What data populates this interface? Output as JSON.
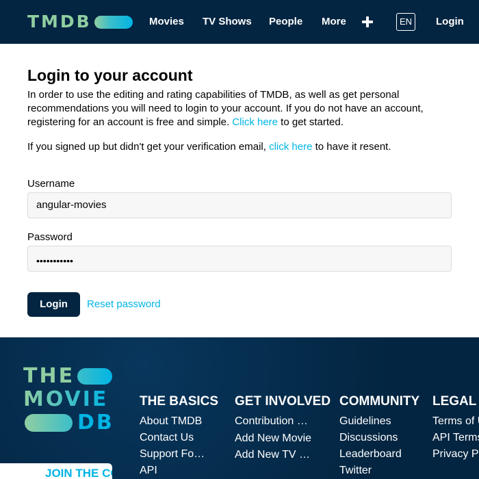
{
  "header": {
    "logo_text": "TMDB",
    "nav": [
      "Movies",
      "TV Shows",
      "People",
      "More"
    ],
    "add_icon": "plus-icon",
    "language": "EN",
    "login": "Login"
  },
  "main": {
    "title": "Login to your account",
    "intro_text": "In order to use the editing and rating capabilities of TMDB, as well as get personal recommendations you will need to login to your account. If you do not have an account, registering for an account is free and simple. ",
    "intro_link": "Click here",
    "intro_after": " to get started.",
    "verify_before": "If you signed up but didn't get your verification email, ",
    "verify_link": "click here",
    "verify_after": " to have it resent.",
    "username_label": "Username",
    "username_value": "angular-movies",
    "password_label": "Password",
    "password_value": "•••••••••••",
    "login_button": "Login",
    "reset_link": "Reset password"
  },
  "footer": {
    "logo_lines": [
      "THE",
      "MOVIE",
      "DB"
    ],
    "join_button": "JOIN THE COMMUNITY",
    "columns": [
      {
        "title": "The Basics",
        "links": [
          "About TMDB",
          "Contact Us",
          "Support Forums",
          "API"
        ]
      },
      {
        "title": "Get Involved",
        "links": [
          "Contribution Bible",
          "Add New Movie",
          "Add New TV Show"
        ]
      },
      {
        "title": "Community",
        "links": [
          "Guidelines",
          "Discussions",
          "Leaderboard",
          "Twitter"
        ]
      },
      {
        "title": "Legal",
        "links": [
          "Terms of Use",
          "API Terms of Use",
          "Privacy Policy"
        ]
      }
    ]
  },
  "colors": {
    "navy": "#032541",
    "accent_blue": "#01b4e4",
    "accent_green": "#90cea1"
  }
}
